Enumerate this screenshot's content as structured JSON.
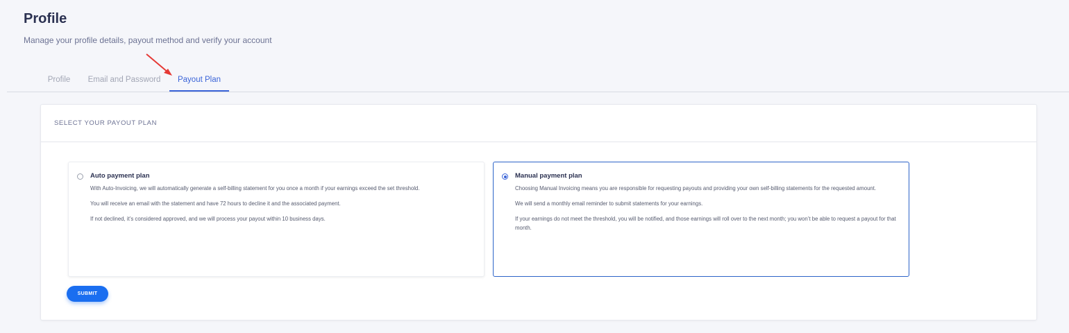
{
  "header": {
    "title": "Profile",
    "subtitle": "Manage your profile details, payout method and verify your account"
  },
  "tabs": [
    {
      "label": "Profile",
      "active": false
    },
    {
      "label": "Email and Password",
      "active": false
    },
    {
      "label": "Payout Plan",
      "active": true
    }
  ],
  "card": {
    "heading": "SELECT YOUR PAYOUT PLAN",
    "plans": [
      {
        "title": "Auto payment plan",
        "selected": false,
        "paragraphs": [
          "With Auto-Invoicing, we will automatically generate a self-billing statement for you once a month if your earnings exceed the set threshold.",
          "You will receive an email with the statement and have 72 hours to decline it and the associated payment.",
          "If not declined, it’s considered approved, and we will process your payout within 10 business days."
        ]
      },
      {
        "title": "Manual payment plan",
        "selected": true,
        "paragraphs": [
          "Choosing Manual Invoicing means you are responsible for requesting payouts and providing your own self-billing statements for the requested amount.",
          "We will send a monthly email reminder to submit statements for your earnings.",
          "If your earnings do not meet the threshold, you will be notified, and those earnings will roll over to the next month; you won’t be able to request a payout for that month."
        ]
      }
    ],
    "submit_label": "SUBMIT"
  },
  "colors": {
    "accent": "#3a64d8",
    "button": "#1a6ef0",
    "annotation_arrow": "#e53935"
  }
}
